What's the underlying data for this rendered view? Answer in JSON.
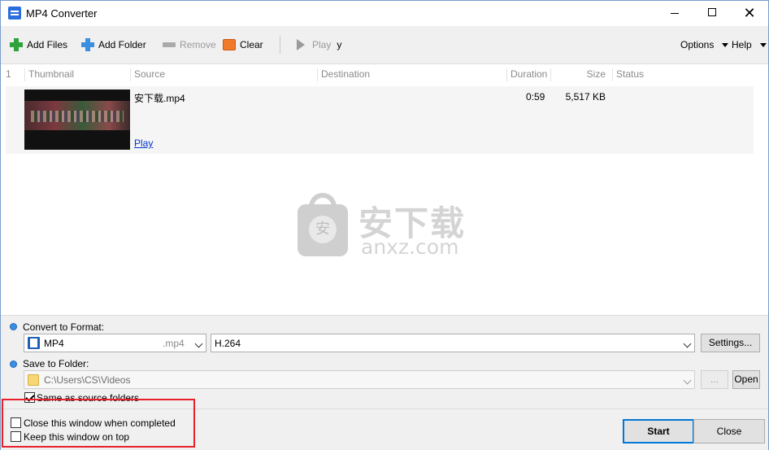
{
  "window": {
    "title": "MP4 Converter",
    "controls": {
      "minimize": "",
      "maximize": "",
      "close": "✕"
    }
  },
  "toolbar": {
    "add_files": "Add Files",
    "add_folder": "Add Folder",
    "remove": "Remove",
    "clear": "Clear",
    "play": "Play",
    "play_suffix": "y",
    "options": "Options",
    "help": "Help"
  },
  "list": {
    "columns": [
      "1",
      "Thumbnail",
      "Source",
      "Destination",
      "Duration",
      "Size",
      "Status"
    ],
    "rows": [
      {
        "source": "安下载.mp4",
        "play_link": "Play",
        "destination": "",
        "duration": "0:59",
        "size": "5,517 KB",
        "status": ""
      }
    ]
  },
  "watermark": {
    "cn": "安下载",
    "en": "anxz.com",
    "bag_glyph": "安"
  },
  "convert": {
    "label": "Convert to Format:",
    "format": "MP4",
    "format_ext": ".mp4",
    "codec": "H.264",
    "settings_button": "Settings..."
  },
  "save": {
    "label": "Save to Folder:",
    "path": "C:\\Users\\CS\\Videos",
    "browse_button": "...",
    "open_button": "Open",
    "same_as_source_label": "Same as source folders",
    "same_as_source_checked": true
  },
  "footer": {
    "close_when_completed": "Close this window when completed",
    "keep_on_top": "Keep this window on top",
    "start_button": "Start",
    "close_button": "Close"
  },
  "colors": {
    "accent": "#0078d7",
    "highlight": "#e8202a",
    "link": "#0033cc"
  }
}
